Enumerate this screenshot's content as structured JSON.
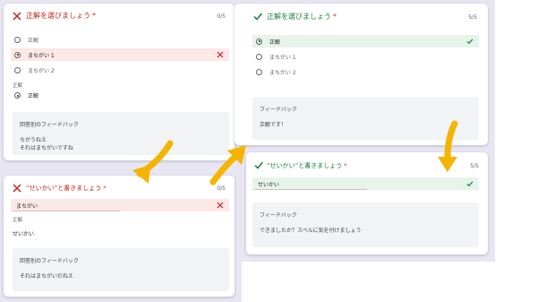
{
  "colors": {
    "wrong": "#c5221f",
    "correct": "#188038",
    "wrong_bg": "#fce8e6",
    "correct_bg": "#e6f4ea",
    "arrow": "#f4b400",
    "page_bg": "#e8e6f3"
  },
  "card1": {
    "status_icon": "close-icon",
    "title": "正解を選びましょう",
    "required_mark": "*",
    "score": "0/5",
    "options": [
      {
        "label": "正解",
        "selected": false
      },
      {
        "label": "まちがい 1",
        "selected": true,
        "status_icon": "close-icon"
      },
      {
        "label": "まちがい 2",
        "selected": false
      }
    ],
    "correct_answer_label": "正解",
    "correct_answer": "正解",
    "feedback_title": "回答別のフィードバック",
    "feedback_lines": [
      "ちがうねえ",
      "それはまちがいですね"
    ]
  },
  "card2": {
    "status_icon": "check-icon",
    "title": "正解を選びましょう",
    "required_mark": "*",
    "score": "5/5",
    "options": [
      {
        "label": "正解",
        "selected": true,
        "status_icon": "check-icon"
      },
      {
        "label": "まちがい 1",
        "selected": false
      },
      {
        "label": "まちがい 2",
        "selected": false
      }
    ],
    "feedback_title": "フィードバック",
    "feedback_lines": [
      "正解です！"
    ]
  },
  "card3": {
    "status_icon": "close-icon",
    "title": "“せいかい”と書きましょう",
    "required_mark": "*",
    "score": "0/5",
    "answer": "まちがい",
    "answer_status_icon": "close-icon",
    "correct_answer_label": "正解",
    "correct_answer": "せいかい",
    "feedback_title": "回答別のフィードバック",
    "feedback_lines": [
      "それはまちがいだねえ"
    ]
  },
  "card4": {
    "status_icon": "check-icon",
    "title": "“せいかい”と書きましょう",
    "required_mark": "*",
    "score": "5/5",
    "answer": "せいかい",
    "answer_status_icon": "check-icon",
    "feedback_title": "フィードバック",
    "feedback_lines": [
      "できましたか？スペルに気を付けましょう"
    ]
  }
}
